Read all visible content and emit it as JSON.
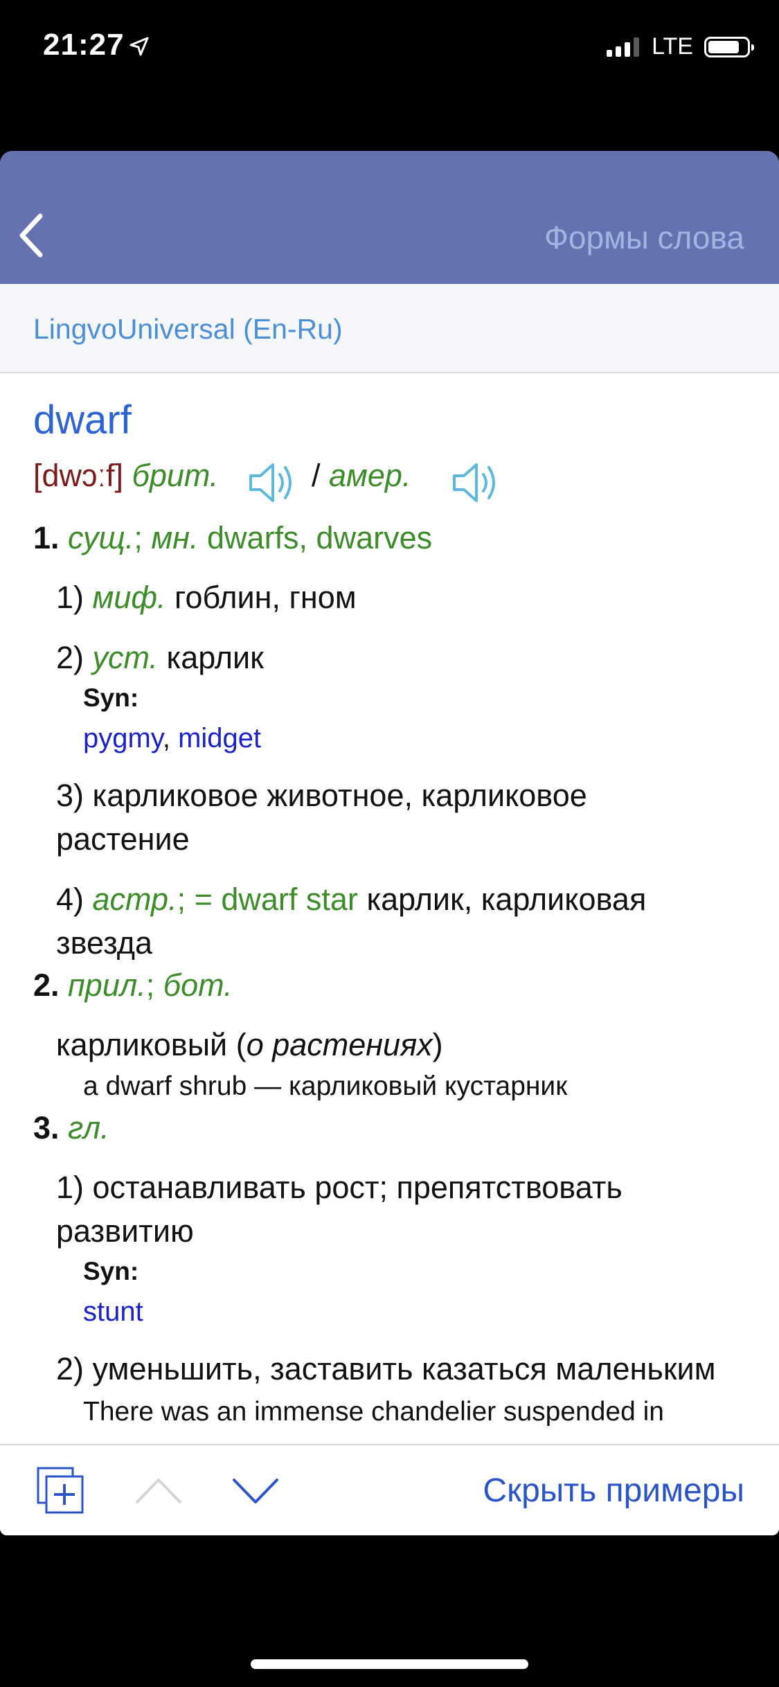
{
  "status_bar": {
    "time": "21:27",
    "network": "LTE"
  },
  "nav": {
    "back_icon": "chevron-left-icon",
    "title": "Формы слова"
  },
  "dictionary": {
    "name": "LingvoUniversal (En-Ru)"
  },
  "entry": {
    "headword": "dwarf",
    "transcription": "[dwɔːf]",
    "brit": "брит.",
    "slash": "/",
    "amer": "амер.",
    "sense1": {
      "num": "1.",
      "pos": "сущ.",
      "sep": ";",
      "mn": "мн.",
      "plurals": "dwarfs, dwarves",
      "items": [
        {
          "num": "1)",
          "label": "миф.",
          "text": "гоблин, гном"
        },
        {
          "num": "2)",
          "label": "уст.",
          "text": "карлик",
          "syn_label": "Syn:",
          "syn": [
            "pygmy",
            "midget"
          ]
        },
        {
          "num": "3)",
          "text_line1": "карликовое животное, карликовое",
          "text_line2": "растение"
        },
        {
          "num": "4)",
          "label": "астр.",
          "ref": "; = dwarf star",
          "text_line1": "карлик, карликовая",
          "text_line2": "звезда"
        }
      ]
    },
    "sense2": {
      "num": "2.",
      "pos": "прил.",
      "sep": ";",
      "label": "бот.",
      "text": "карликовый (",
      "text_ital": "о растениях",
      "text_end": ")",
      "example": "a dwarf shrub — карликовый кустарник"
    },
    "sense3": {
      "num": "3.",
      "pos": "гл.",
      "items": [
        {
          "num": "1)",
          "text_line1": "останавливать рост; препятствовать",
          "text_line2": "развитию",
          "syn_label": "Syn:",
          "syn": [
            "stunt"
          ]
        },
        {
          "num": "2)",
          "text": "уменьшить, заставить казаться маленьким",
          "example": "There was an immense chandelier suspended in"
        }
      ]
    }
  },
  "toolbar": {
    "add_icon": "add-to-cards-icon",
    "up_icon": "chevron-up-icon",
    "down_icon": "chevron-down-icon",
    "hide_examples": "Скрыть примеры"
  },
  "colors": {
    "nav_bar": "#6572b1",
    "headword": "#2e63d2",
    "label_green": "#3c8d2a",
    "link_blue": "#1a22c9",
    "transcription": "#7b1c1c"
  }
}
